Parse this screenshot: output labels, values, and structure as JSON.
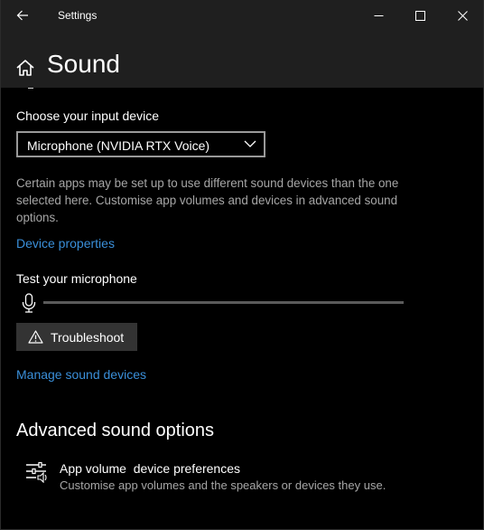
{
  "window": {
    "title": "Settings"
  },
  "page": {
    "title": "Sound"
  },
  "input": {
    "label": "Choose your input device",
    "selected_device": "Microphone (NVIDIA RTX Voice)",
    "description": "Certain apps may be set up to use different sound devices than the one selected here. Customise app volumes and devices in advanced sound options.",
    "device_properties_link": "Device properties",
    "test_label": "Test your microphone",
    "mic_level_fraction": 0,
    "troubleshoot_label": "Troubleshoot",
    "manage_devices_link": "Manage sound devices"
  },
  "advanced": {
    "section_title": "Advanced sound options",
    "app_volume_title": "App volume  device preferences",
    "app_volume_subtitle": "Customise app volumes and the speakers or devices they use."
  },
  "icons": {
    "back": "back-arrow-icon",
    "minimize": "minimize-icon",
    "maximize": "maximize-icon",
    "close": "close-icon",
    "home": "home-icon",
    "dropdown": "chevron-down-icon",
    "microphone": "microphone-icon",
    "warning": "warning-icon",
    "app_volume": "sliders-icon"
  },
  "colors": {
    "background": "#000000",
    "titlebar": "#1f1f1f",
    "link": "#3a8fd9",
    "secondary_text": "#a6a6a6",
    "button_bg": "#333333",
    "track": "#5a5a5a"
  }
}
